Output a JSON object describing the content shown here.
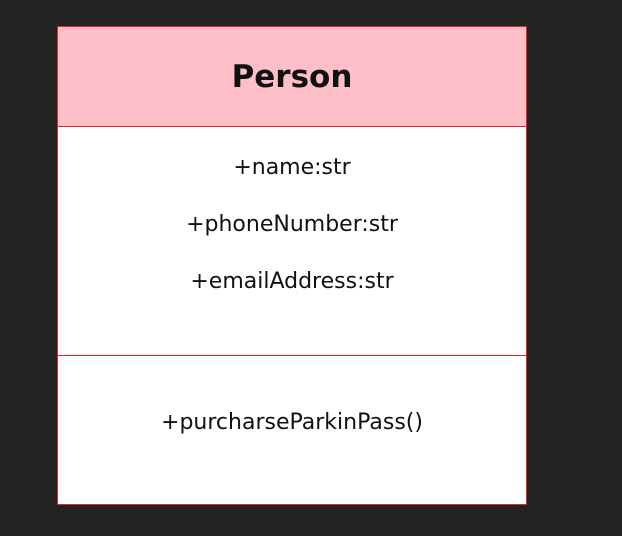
{
  "class": {
    "name": "Person",
    "attributes": [
      "+name:str",
      "+phoneNumber:str",
      "+emailAddress:str"
    ],
    "methods": [
      "+purcharseParkinPass()"
    ]
  },
  "colors": {
    "background": "#232323",
    "header_fill": "#ffbfc8",
    "border": "#e0262b",
    "body_fill": "#ffffff"
  }
}
